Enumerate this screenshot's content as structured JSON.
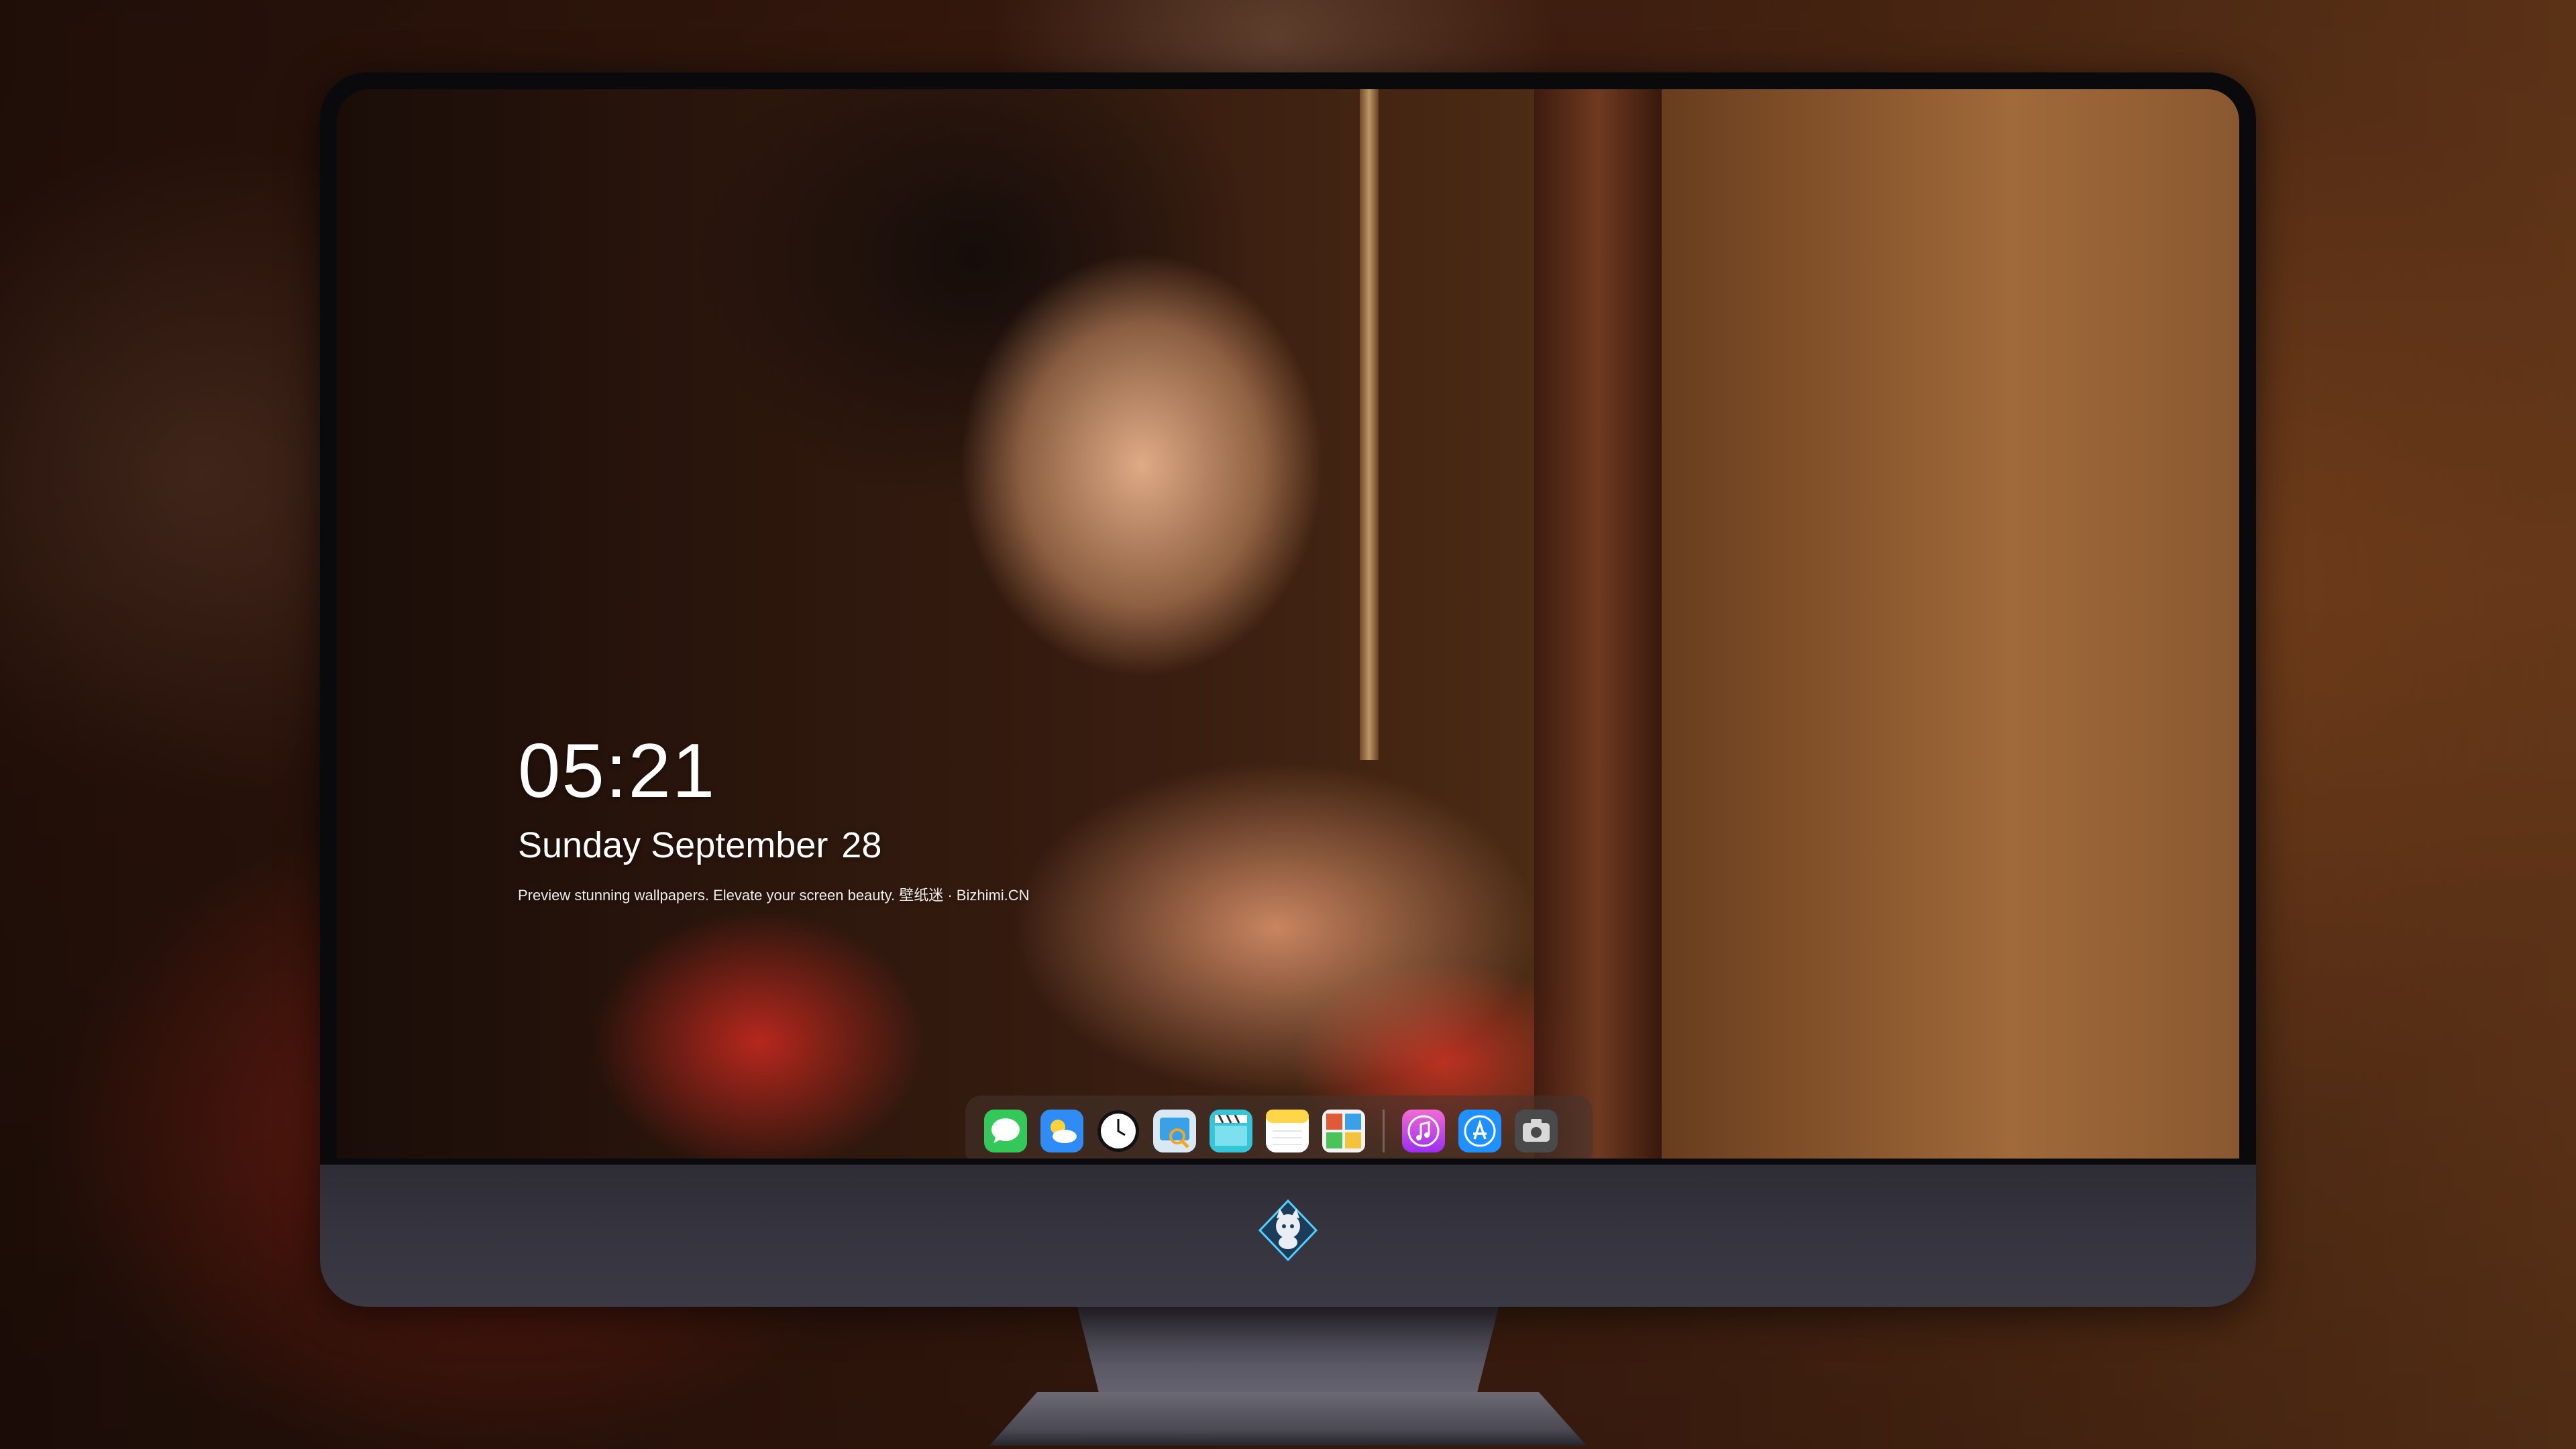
{
  "lockscreen": {
    "time": "05:21",
    "weekday_month": "Sunday September",
    "day": "28",
    "caption": "Preview stunning wallpapers. Elevate your screen beauty. 壁纸迷 · Bizhimi.CN"
  },
  "dock": {
    "apps": [
      {
        "name": "Messages",
        "icon": "messages-icon",
        "color": "#34c759"
      },
      {
        "name": "Weather",
        "icon": "weather-icon",
        "color": "#2f8cf5"
      },
      {
        "name": "Clock",
        "icon": "clock-icon",
        "color": "#111111"
      },
      {
        "name": "Preview",
        "icon": "preview-icon",
        "color": "#d9e8f5"
      },
      {
        "name": "Clips",
        "icon": "clips-icon",
        "color": "#36c5d8"
      },
      {
        "name": "Notes",
        "icon": "notes-icon",
        "color": "#ffd54a"
      },
      {
        "name": "Photo Booth",
        "icon": "photo-booth-icon",
        "color": "#e05a3a"
      },
      {
        "name": "iTunes",
        "icon": "music-icon",
        "color": "#c13cf0"
      },
      {
        "name": "App Store",
        "icon": "app-store-icon",
        "color": "#1e90ff"
      },
      {
        "name": "Screenshot",
        "icon": "camera-icon",
        "color": "#4a4a4a"
      }
    ]
  },
  "monitor": {
    "logo": "mascot-logo-icon"
  }
}
